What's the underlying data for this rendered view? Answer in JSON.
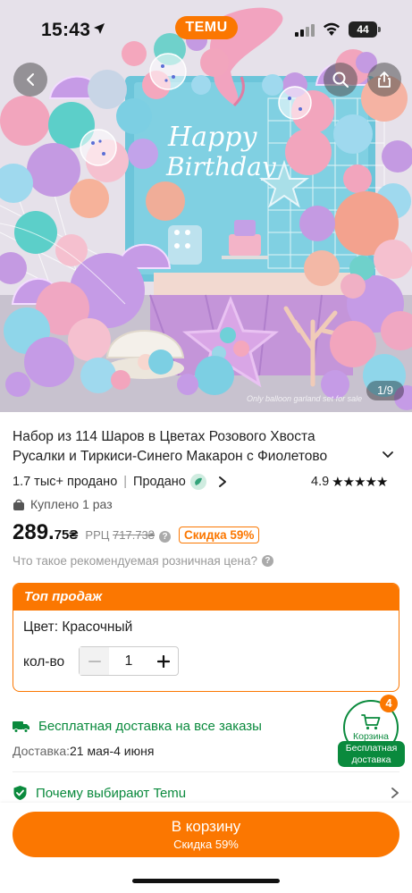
{
  "status_bar": {
    "time": "15:43",
    "battery": "44"
  },
  "brand": {
    "name": "TEMU",
    "accent": "#fb7701",
    "green": "#0a8a3d"
  },
  "gallery": {
    "counter": "1/9",
    "caption": "Only balloon garland set for sale",
    "banner_line1": "Happy",
    "banner_line2": "Birthday"
  },
  "product": {
    "title": "Набор из 114 Шаров в Цветах Розового Хвоста Русалки и Тиркиси-Синего Макарон с Фиолетово",
    "sold": "1.7 тыс+ продано",
    "seller": "Продано",
    "rating": "4.9",
    "stars": "★★★★★",
    "bought": "Куплено 1 раз",
    "price_main": "289.",
    "price_cents": "75₴",
    "rrp_label": "РРЦ",
    "rrp_value": "717.73₴",
    "discount": "Скидка 59%",
    "rrp_question": "Что такое рекомендуемая розничная цена?"
  },
  "options": {
    "header": "Топ продаж",
    "color": "Цвет: Красочный",
    "qty_label": "кол-во",
    "qty_value": "1"
  },
  "shipping": {
    "free": "Бесплатная доставка на все заказы",
    "delivery_label": "Доставка:",
    "delivery_dates": "21 мая-4 июня"
  },
  "why": {
    "label": "Почему выбирают Temu"
  },
  "cart": {
    "count": "4",
    "label": "Корзина",
    "free_line1": "Бесплатная",
    "free_line2": "доставка"
  },
  "cta": {
    "main": "В корзину",
    "sub": "Скидка 59%"
  },
  "icons": [
    "location-arrow-icon",
    "signal-icon",
    "wifi-icon",
    "battery-icon",
    "back-icon",
    "search-icon",
    "share-icon",
    "chevron-down-icon",
    "chevron-right-icon",
    "seller-badge-icon",
    "star-icon",
    "bag-icon",
    "info-icon",
    "minus-icon",
    "plus-icon",
    "truck-icon",
    "shield-check-icon",
    "cart-icon"
  ]
}
